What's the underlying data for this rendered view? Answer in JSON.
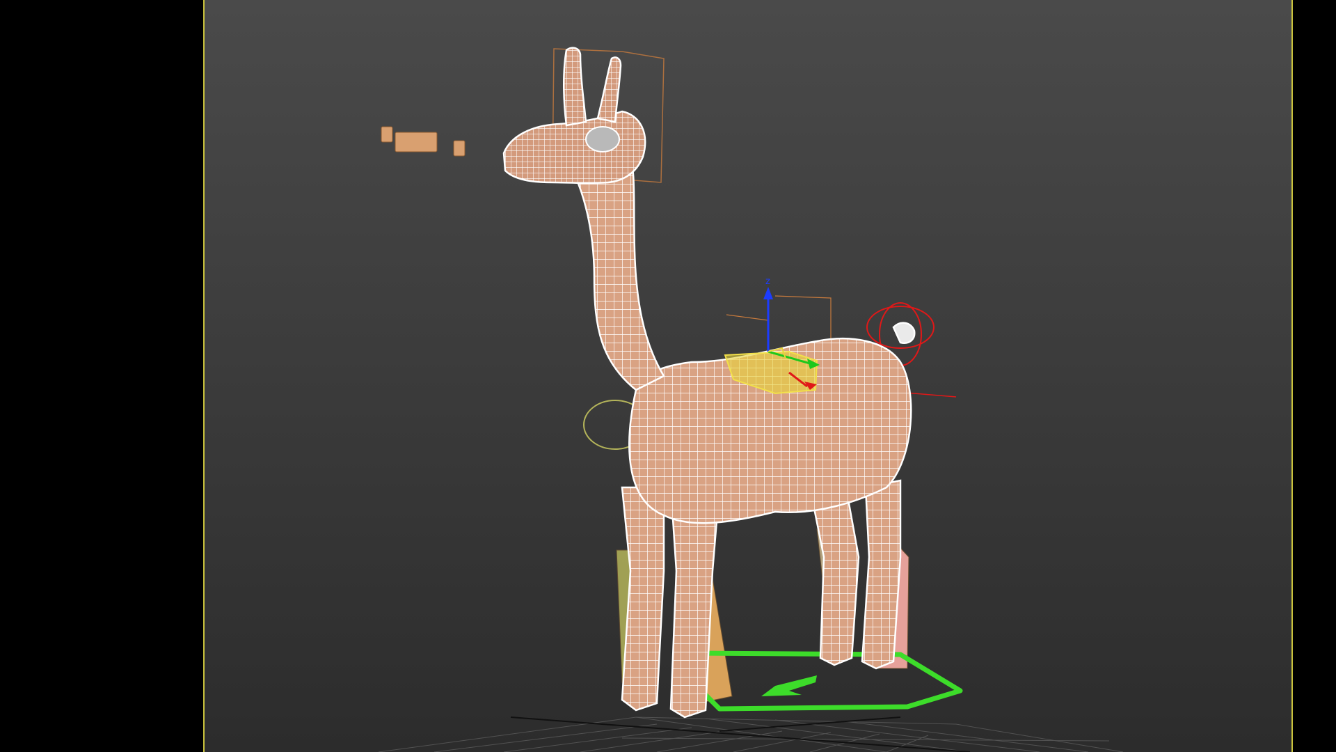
{
  "viewport": {
    "active_border_color": "#c9c23c",
    "background_top": "#4a4a4a",
    "background_bottom": "#2e2e2e"
  },
  "scene": {
    "model_color": "#d9a283",
    "wire_color": "#ffffff",
    "selection_color": "#c77a3d",
    "rig_green": "#3ddc2a",
    "rig_red": "#e01818",
    "rig_yellow": "#e8d43a",
    "rig_orange": "#d9a25a",
    "rig_pink": "#e6a19a",
    "rig_olive": "#b4b45a"
  },
  "gizmo": {
    "z_axis_label": "z",
    "z_color": "#1c3cff",
    "x_color": "#e01818",
    "y_color": "#1cc81c"
  }
}
